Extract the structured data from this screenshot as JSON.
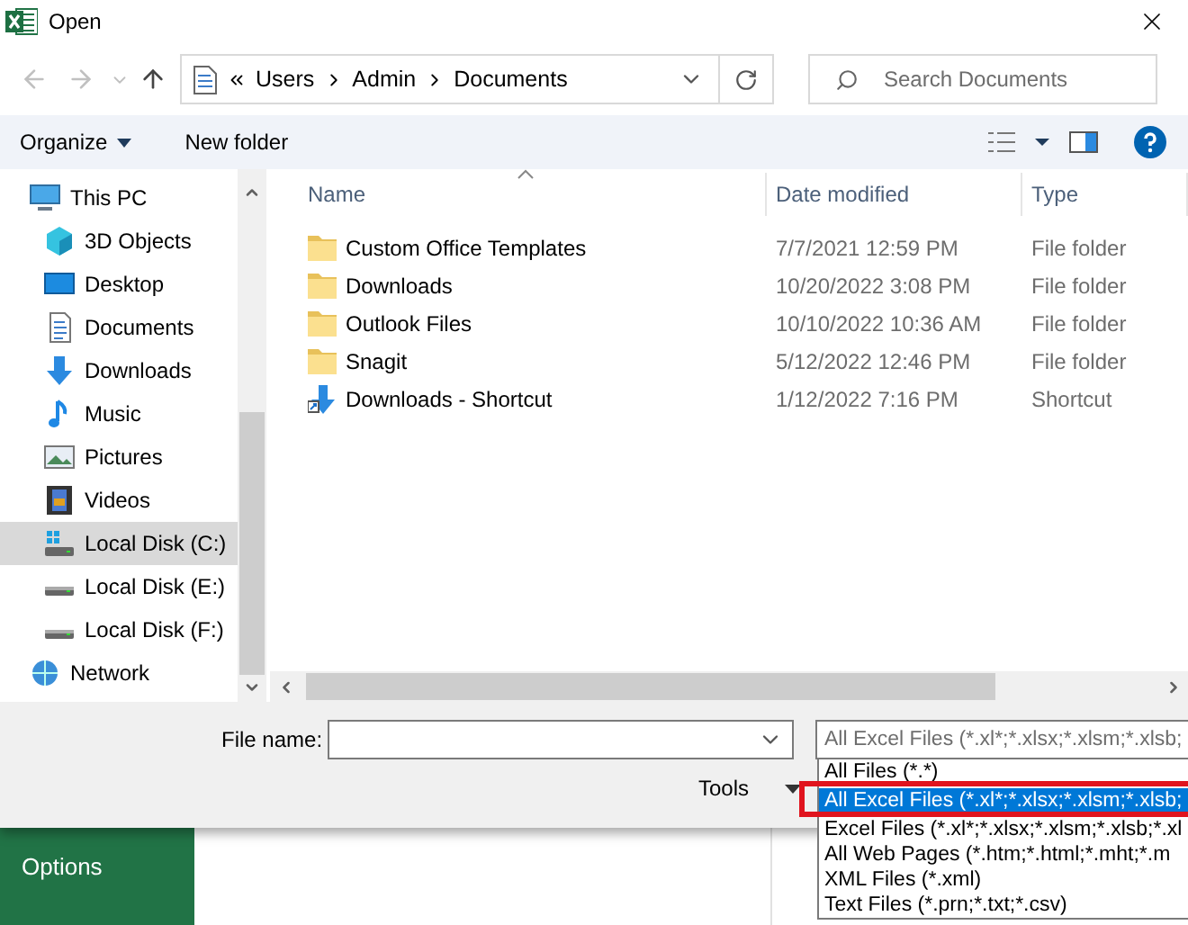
{
  "window": {
    "title": "Open"
  },
  "address_bar": {
    "segments": [
      "Users",
      "Admin",
      "Documents"
    ]
  },
  "search": {
    "placeholder": "Search Documents"
  },
  "command_bar": {
    "organize": "Organize",
    "new_folder": "New folder"
  },
  "nav_pane": {
    "items": [
      {
        "label": "This PC",
        "kind": "pc",
        "selected": false,
        "children": [
          {
            "label": "3D Objects",
            "kind": "cube",
            "selected": false
          },
          {
            "label": "Desktop",
            "kind": "desktop",
            "selected": false
          },
          {
            "label": "Documents",
            "kind": "documents",
            "selected": false
          },
          {
            "label": "Downloads",
            "kind": "download",
            "selected": false
          },
          {
            "label": "Music",
            "kind": "music",
            "selected": false
          },
          {
            "label": "Pictures",
            "kind": "pictures",
            "selected": false
          },
          {
            "label": "Videos",
            "kind": "videos",
            "selected": false
          },
          {
            "label": "Local Disk (C:)",
            "kind": "system-drive",
            "selected": true
          },
          {
            "label": "Local Disk (E:)",
            "kind": "drive",
            "selected": false
          },
          {
            "label": "Local Disk (F:)",
            "kind": "drive",
            "selected": false
          }
        ]
      },
      {
        "label": "Network",
        "kind": "network",
        "selected": false
      }
    ]
  },
  "file_list": {
    "columns": [
      "Name",
      "Date modified",
      "Type"
    ],
    "rows": [
      {
        "name": "Custom Office Templates",
        "date": "7/7/2021 12:59 PM",
        "type": "File folder",
        "kind": "folder"
      },
      {
        "name": "Downloads",
        "date": "10/20/2022 3:08 PM",
        "type": "File folder",
        "kind": "folder"
      },
      {
        "name": "Outlook Files",
        "date": "10/10/2022 10:36 AM",
        "type": "File folder",
        "kind": "folder"
      },
      {
        "name": "Snagit",
        "date": "5/12/2022 12:46 PM",
        "type": "File folder",
        "kind": "folder"
      },
      {
        "name": "Downloads - Shortcut",
        "date": "1/12/2022 7:16 PM",
        "type": "Shortcut",
        "kind": "shortcut"
      }
    ]
  },
  "file_name": {
    "label": "File name:"
  },
  "file_type": {
    "value": "All Excel Files (*.xl*;*.xlsx;*.xlsm;*.xlsb;",
    "options": [
      {
        "label": "All Files (*.*)",
        "selected": false
      },
      {
        "label": "All Excel Files (*.xl*;*.xlsx;*.xlsm;*.xlsb;",
        "selected": true
      },
      {
        "label": "Excel Files (*.xl*;*.xlsx;*.xlsm;*.xlsb;*.xl",
        "selected": false
      },
      {
        "label": "All Web Pages (*.htm;*.html;*.mht;*.m",
        "selected": false
      },
      {
        "label": "XML Files (*.xml)",
        "selected": false
      },
      {
        "label": "Text Files (*.prn;*.txt;*.csv)",
        "selected": false
      }
    ]
  },
  "tools": "Tools",
  "background_app": {
    "sidebar": [
      "Options"
    ]
  }
}
